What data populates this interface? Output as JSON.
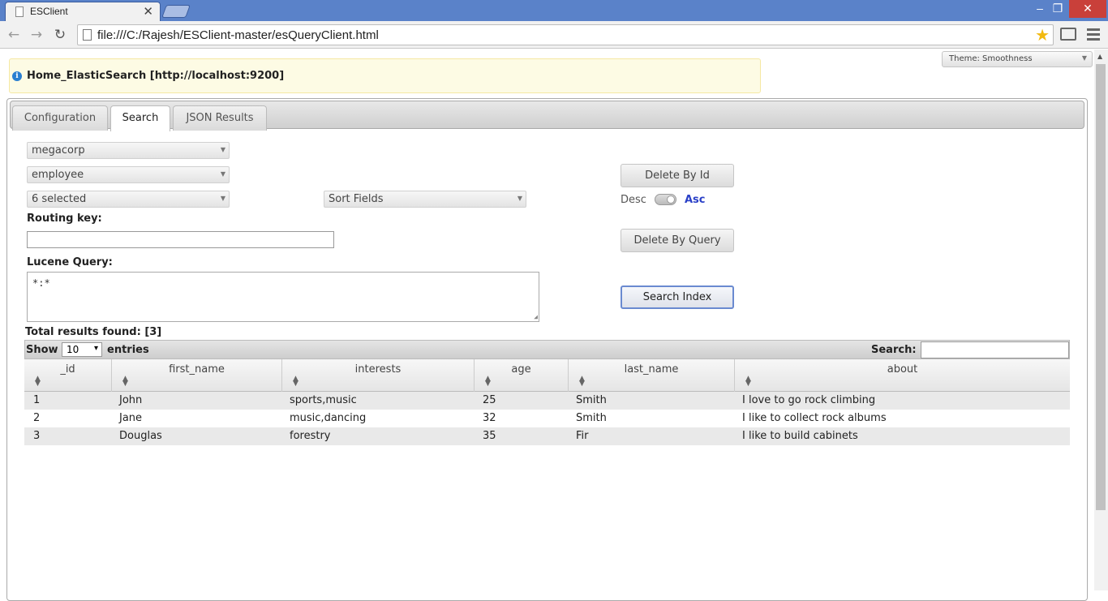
{
  "browser": {
    "tab_title": "ESClient",
    "url": "file:///C:/Rajesh/ESClient-master/esQueryClient.html"
  },
  "theme": {
    "label": "Theme: Smoothness"
  },
  "info": {
    "text": "Home_ElasticSearch [http://localhost:9200]"
  },
  "tabs": [
    {
      "label": "Configuration"
    },
    {
      "label": "Search"
    },
    {
      "label": "JSON Results"
    }
  ],
  "form": {
    "index_select": "megacorp",
    "type_select": "employee",
    "fields_select": "6 selected",
    "sort_select": "Sort Fields",
    "routing_label": "Routing key:",
    "routing_value": "",
    "query_label": "Lucene Query:",
    "query_value": "*:*",
    "delete_by_id": "Delete By Id",
    "delete_by_query": "Delete By Query",
    "search_button": "Search Index",
    "desc_label": "Desc",
    "asc_label": "Asc"
  },
  "results": {
    "total_label": "Total results found: [3]",
    "show_label": "Show",
    "page_length": "10",
    "entries_label": "entries",
    "search_label": "Search:",
    "columns": [
      "_id",
      "first_name",
      "interests",
      "age",
      "last_name",
      "about"
    ],
    "rows": [
      [
        "1",
        "John",
        "sports,music",
        "25",
        "Smith",
        "I love to go rock climbing"
      ],
      [
        "2",
        "Jane",
        "music,dancing",
        "32",
        "Smith",
        "I like to collect rock albums"
      ],
      [
        "3",
        "Douglas",
        "forestry",
        "35",
        "Fir",
        "I like to build cabinets"
      ]
    ]
  }
}
